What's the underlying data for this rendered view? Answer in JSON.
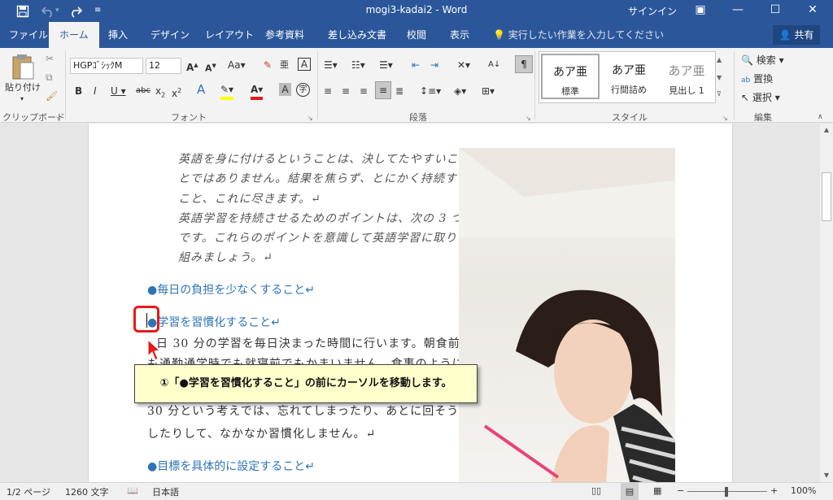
{
  "titlebar": {
    "title": "mogi3-kadai2  -  Word",
    "signin": "サインイン",
    "save_icon": "save-icon",
    "undo_icon": "undo-icon",
    "redo_icon": "redo-icon"
  },
  "tabs": [
    "ファイル",
    "ホーム",
    "挿入",
    "デザイン",
    "レイアウト",
    "参考資料",
    "差し込み文書",
    "校閲",
    "表示"
  ],
  "tellme": "実行したい作業を入力してください",
  "share": "共有",
  "ribbon": {
    "clipboard": {
      "paste": "貼り付け",
      "label": "クリップボード"
    },
    "font": {
      "name": "HGPｺﾞｼｯｸM",
      "size": "12",
      "label": "フォント"
    },
    "paragraph": {
      "label": "段落"
    },
    "styles": {
      "items": [
        {
          "sample": "あア亜",
          "name": "標準"
        },
        {
          "sample": "あア亜",
          "name": "行間詰め"
        },
        {
          "sample": "あア亜",
          "name": "見出し 1"
        }
      ],
      "label": "スタイル"
    },
    "edit": {
      "find": "検索",
      "replace": "置換",
      "select": "選択",
      "label": "編集"
    }
  },
  "document": {
    "italic_lines": [
      "英語を身に付けるということは、決してたやすいこ",
      "とではありません。結果を焦らず、とにかく持続する",
      "こと、これに尽きます。↵",
      "英語学習を持続させるためのポイントは、次の 3 つ",
      "です。これらのポイントを意識して英語学習に取り",
      "組みましょう。↵"
    ],
    "heading1": "●毎日の負担を少なくすること↵",
    "heading2": "●学習を習慣化すること↵",
    "body_lines": [
      "日 30 分の学習を毎日決まった時間に行います。朝食前で",
      "も通勤通学時でも就寝前でもかまいません。食事のように生",
      "30 分という考えでは、忘れてしまったり、あとに回そうと",
      "したりして、なかなか習慣化しません。↵"
    ],
    "heading3": "●目標を具体的に設定すること↵"
  },
  "callout": "①「●学習を習慣化すること」の前にカーソルを移動します。",
  "status": {
    "page": "1/2 ページ",
    "words": "1260 文字",
    "lang": "日本語",
    "zoom": "100%"
  }
}
